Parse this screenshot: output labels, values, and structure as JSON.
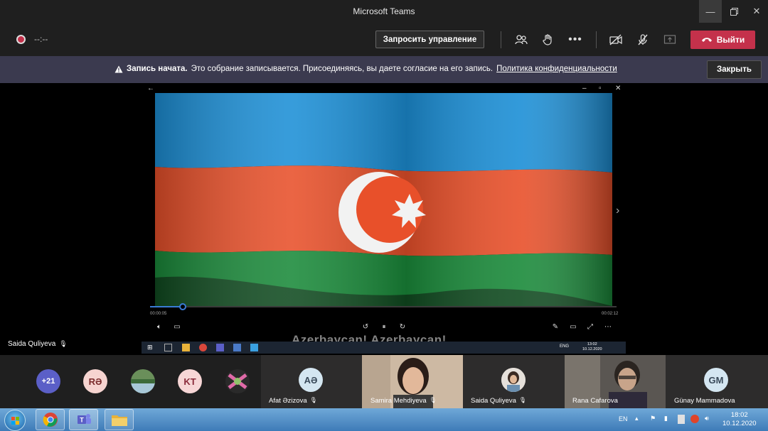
{
  "window": {
    "title": "Microsoft Teams"
  },
  "toolbar": {
    "timer": "--:--",
    "request_control_label": "Запросить управление",
    "leave_label": "Выйти"
  },
  "banner": {
    "title": "Запись начата.",
    "message": "Это собрание записывается. Присоединяясь, вы даете согласие на его запись.",
    "link": "Политика конфиденциальности",
    "close_label": "Закрыть"
  },
  "player": {
    "progress": 0.07,
    "time_current": "00:00:05",
    "time_total": "00:02:12",
    "subtitle": "Azerbaycan! Azerbaycan!"
  },
  "remote_taskbar": {
    "lang": "ENG",
    "time": "13:02",
    "date": "10.12.2020"
  },
  "presenter": {
    "name": "Saida Quliyeva"
  },
  "participants": {
    "overflow_count": "+21",
    "avatars": [
      {
        "initials": "RƏ",
        "bg": "#f6d4d0",
        "fg": "#7a2b2b"
      },
      {
        "initials": "",
        "bg": "#6a8f5a"
      },
      {
        "initials": "KT",
        "bg": "#f7d6d6",
        "fg": "#8a2a3a"
      },
      {
        "initials": "",
        "bg": "#8b6a9a"
      }
    ],
    "tiles": [
      {
        "name": "Afat Əzizova",
        "initials": "AƏ"
      },
      {
        "name": "Samira Mehdiyeva"
      },
      {
        "name": "Saida Quliyeva"
      },
      {
        "name": "Rana Cafarova"
      },
      {
        "name": "Günay Mammadova",
        "initials": "GM"
      }
    ]
  },
  "system_taskbar": {
    "lang": "EN",
    "time": "18:02",
    "date": "10.12.2020"
  },
  "colors": {
    "accent_red": "#c4314b",
    "banner_bg": "#3b3a4f",
    "flag_blue": "#1c8fd6",
    "flag_red": "#e8502a",
    "flag_green": "#1a8a3a"
  }
}
